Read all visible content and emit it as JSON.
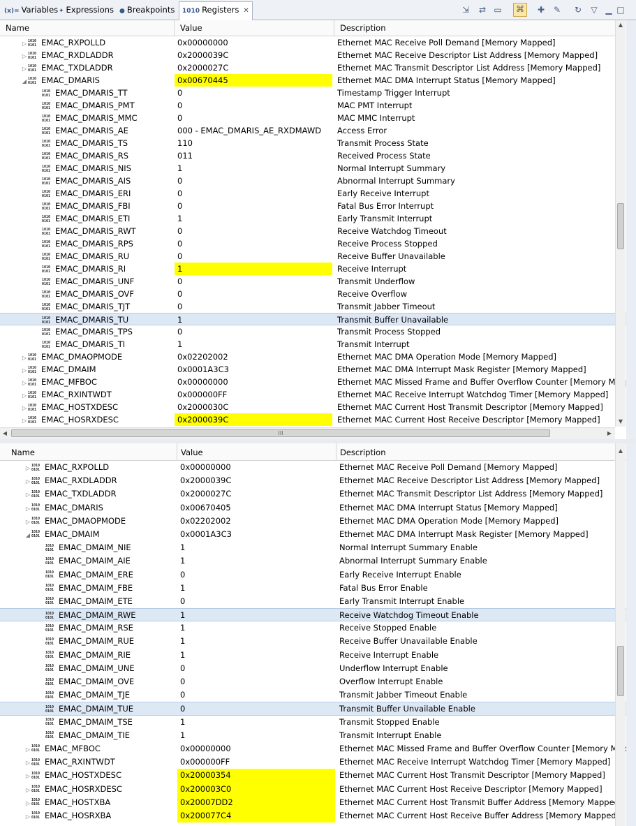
{
  "tabs": [
    {
      "icon": "(x)=",
      "label": "Variables",
      "active": false
    },
    {
      "icon": "✦",
      "label": "Expressions",
      "active": false
    },
    {
      "icon": "●",
      "label": "Breakpoints",
      "active": false
    },
    {
      "icon": "1010",
      "label": "Registers",
      "active": true
    }
  ],
  "columns": {
    "name": "Name",
    "value": "Value",
    "description": "Description"
  },
  "scroll_marker": "III",
  "highlight_color": "#ffff00",
  "top_pane": {
    "rows": [
      {
        "level": 1,
        "expand": "collapsed",
        "name": "EMAC_RXPOLLD",
        "value": "0x00000000",
        "desc": "Ethernet MAC Receive Poll Demand [Memory Mapped]"
      },
      {
        "level": 1,
        "expand": "collapsed",
        "name": "EMAC_RXDLADDR",
        "value": "0x2000039C",
        "desc": "Ethernet MAC Receive Descriptor List Address [Memory Mapped]"
      },
      {
        "level": 1,
        "expand": "collapsed",
        "name": "EMAC_TXDLADDR",
        "value": "0x2000027C",
        "desc": "Ethernet MAC Transmit Descriptor List Address [Memory Mapped]"
      },
      {
        "level": 1,
        "expand": "expanded",
        "name": "EMAC_DMARIS",
        "value": "0x00670445",
        "desc": "Ethernet MAC DMA Interrupt Status [Memory Mapped]",
        "highlight": true
      },
      {
        "level": 2,
        "name": "EMAC_DMARIS_TT",
        "value": "0",
        "desc": "Timestamp Trigger Interrupt"
      },
      {
        "level": 2,
        "name": "EMAC_DMARIS_PMT",
        "value": "0",
        "desc": "MAC PMT Interrupt"
      },
      {
        "level": 2,
        "name": "EMAC_DMARIS_MMC",
        "value": "0",
        "desc": "MAC MMC Interrupt"
      },
      {
        "level": 2,
        "name": "EMAC_DMARIS_AE",
        "value": "000 - EMAC_DMARIS_AE_RXDMAWD",
        "desc": "Access Error"
      },
      {
        "level": 2,
        "name": "EMAC_DMARIS_TS",
        "value": "110",
        "desc": "Transmit Process State"
      },
      {
        "level": 2,
        "name": "EMAC_DMARIS_RS",
        "value": "011",
        "desc": "Received Process State"
      },
      {
        "level": 2,
        "name": "EMAC_DMARIS_NIS",
        "value": "1",
        "desc": "Normal Interrupt Summary"
      },
      {
        "level": 2,
        "name": "EMAC_DMARIS_AIS",
        "value": "0",
        "desc": "Abnormal Interrupt Summary"
      },
      {
        "level": 2,
        "name": "EMAC_DMARIS_ERI",
        "value": "0",
        "desc": "Early Receive Interrupt"
      },
      {
        "level": 2,
        "name": "EMAC_DMARIS_FBI",
        "value": "0",
        "desc": "Fatal Bus Error Interrupt"
      },
      {
        "level": 2,
        "name": "EMAC_DMARIS_ETI",
        "value": "1",
        "desc": "Early Transmit Interrupt"
      },
      {
        "level": 2,
        "name": "EMAC_DMARIS_RWT",
        "value": "0",
        "desc": "Receive Watchdog Timeout"
      },
      {
        "level": 2,
        "name": "EMAC_DMARIS_RPS",
        "value": "0",
        "desc": "Receive Process Stopped"
      },
      {
        "level": 2,
        "name": "EMAC_DMARIS_RU",
        "value": "0",
        "desc": "Receive Buffer Unavailable"
      },
      {
        "level": 2,
        "name": "EMAC_DMARIS_RI",
        "value": "1",
        "desc": "Receive Interrupt",
        "highlight": true
      },
      {
        "level": 2,
        "name": "EMAC_DMARIS_UNF",
        "value": "0",
        "desc": "Transmit Underflow"
      },
      {
        "level": 2,
        "name": "EMAC_DMARIS_OVF",
        "value": "0",
        "desc": "Receive Overflow"
      },
      {
        "level": 2,
        "name": "EMAC_DMARIS_TJT",
        "value": "0",
        "desc": "Transmit Jabber Timeout"
      },
      {
        "level": 2,
        "name": "EMAC_DMARIS_TU",
        "value": "1",
        "desc": "Transmit Buffer Unavailable",
        "selected": true
      },
      {
        "level": 2,
        "name": "EMAC_DMARIS_TPS",
        "value": "0",
        "desc": "Transmit Process Stopped"
      },
      {
        "level": 2,
        "name": "EMAC_DMARIS_TI",
        "value": "1",
        "desc": "Transmit Interrupt"
      },
      {
        "level": 1,
        "expand": "collapsed",
        "name": "EMAC_DMAOPMODE",
        "value": "0x02202002",
        "desc": "Ethernet MAC DMA Operation Mode [Memory Mapped]"
      },
      {
        "level": 1,
        "expand": "collapsed",
        "name": "EMAC_DMAIM",
        "value": "0x0001A3C3",
        "desc": "Ethernet MAC DMA Interrupt Mask Register [Memory Mapped]"
      },
      {
        "level": 1,
        "expand": "collapsed",
        "name": "EMAC_MFBOC",
        "value": "0x00000000",
        "desc": "Ethernet MAC Missed Frame and Buffer Overflow Counter [Memory Mappe"
      },
      {
        "level": 1,
        "expand": "collapsed",
        "name": "EMAC_RXINTWDT",
        "value": "0x000000FF",
        "desc": "Ethernet MAC Receive Interrupt Watchdog Timer [Memory Mapped]"
      },
      {
        "level": 1,
        "expand": "collapsed",
        "name": "EMAC_HOSTXDESC",
        "value": "0x2000030C",
        "desc": "Ethernet MAC Current Host Transmit Descriptor [Memory Mapped]"
      },
      {
        "level": 1,
        "expand": "collapsed",
        "name": "EMAC_HOSRXDESC",
        "value": "0x2000039C",
        "desc": "Ethernet MAC Current Host Receive Descriptor [Memory Mapped]",
        "highlight": true
      }
    ]
  },
  "bottom_pane": {
    "rows": [
      {
        "level": 1,
        "expand": "collapsed",
        "name": "EMAC_RXPOLLD",
        "value": "0x00000000",
        "desc": "Ethernet MAC Receive Poll Demand [Memory Mapped]"
      },
      {
        "level": 1,
        "expand": "collapsed",
        "name": "EMAC_RXDLADDR",
        "value": "0x2000039C",
        "desc": "Ethernet MAC Receive Descriptor List Address [Memory Mapped]"
      },
      {
        "level": 1,
        "expand": "collapsed",
        "name": "EMAC_TXDLADDR",
        "value": "0x2000027C",
        "desc": "Ethernet MAC Transmit Descriptor List Address [Memory Mapped]"
      },
      {
        "level": 1,
        "expand": "collapsed",
        "name": "EMAC_DMARIS",
        "value": "0x00670405",
        "desc": "Ethernet MAC DMA Interrupt Status [Memory Mapped]"
      },
      {
        "level": 1,
        "expand": "collapsed",
        "name": "EMAC_DMAOPMODE",
        "value": "0x02202002",
        "desc": "Ethernet MAC DMA Operation Mode [Memory Mapped]"
      },
      {
        "level": 1,
        "expand": "expanded",
        "name": "EMAC_DMAIM",
        "value": "0x0001A3C3",
        "desc": "Ethernet MAC DMA Interrupt Mask Register [Memory Mapped]"
      },
      {
        "level": 2,
        "name": "EMAC_DMAIM_NIE",
        "value": "1",
        "desc": "Normal Interrupt Summary Enable"
      },
      {
        "level": 2,
        "name": "EMAC_DMAIM_AIE",
        "value": "1",
        "desc": "Abnormal Interrupt Summary Enable"
      },
      {
        "level": 2,
        "name": "EMAC_DMAIM_ERE",
        "value": "0",
        "desc": "Early Receive Interrupt Enable"
      },
      {
        "level": 2,
        "name": "EMAC_DMAIM_FBE",
        "value": "1",
        "desc": "Fatal Bus Error Enable"
      },
      {
        "level": 2,
        "name": "EMAC_DMAIM_ETE",
        "value": "0",
        "desc": "Early Transmit Interrupt Enable"
      },
      {
        "level": 2,
        "name": "EMAC_DMAIM_RWE",
        "value": "1",
        "desc": "Receive Watchdog Timeout Enable",
        "selected": true
      },
      {
        "level": 2,
        "name": "EMAC_DMAIM_RSE",
        "value": "1",
        "desc": "Receive Stopped Enable"
      },
      {
        "level": 2,
        "name": "EMAC_DMAIM_RUE",
        "value": "1",
        "desc": "Receive Buffer Unavailable Enable"
      },
      {
        "level": 2,
        "name": "EMAC_DMAIM_RIE",
        "value": "1",
        "desc": "Receive Interrupt Enable"
      },
      {
        "level": 2,
        "name": "EMAC_DMAIM_UNE",
        "value": "0",
        "desc": "Underflow Interrupt Enable"
      },
      {
        "level": 2,
        "name": "EMAC_DMAIM_OVE",
        "value": "0",
        "desc": "Overflow Interrupt Enable"
      },
      {
        "level": 2,
        "name": "EMAC_DMAIM_TJE",
        "value": "0",
        "desc": "Transmit Jabber Timeout Enable"
      },
      {
        "level": 2,
        "name": "EMAC_DMAIM_TUE",
        "value": "0",
        "desc": "Transmit Buffer Unvailable Enable",
        "selected": true
      },
      {
        "level": 2,
        "name": "EMAC_DMAIM_TSE",
        "value": "1",
        "desc": "Transmit Stopped Enable"
      },
      {
        "level": 2,
        "name": "EMAC_DMAIM_TIE",
        "value": "1",
        "desc": "Transmit Interrupt Enable"
      },
      {
        "level": 1,
        "expand": "collapsed",
        "name": "EMAC_MFBOC",
        "value": "0x00000000",
        "desc": "Ethernet MAC Missed Frame and Buffer Overflow Counter [Memory Mappe"
      },
      {
        "level": 1,
        "expand": "collapsed",
        "name": "EMAC_RXINTWDT",
        "value": "0x000000FF",
        "desc": "Ethernet MAC Receive Interrupt Watchdog Timer [Memory Mapped]"
      },
      {
        "level": 1,
        "expand": "collapsed",
        "name": "EMAC_HOSTXDESC",
        "value": "0x20000354",
        "desc": "Ethernet MAC Current Host Transmit Descriptor [Memory Mapped]",
        "highlight": true
      },
      {
        "level": 1,
        "expand": "collapsed",
        "name": "EMAC_HOSRXDESC",
        "value": "0x200003C0",
        "desc": "Ethernet MAC Current Host Receive Descriptor [Memory Mapped]",
        "highlight": true
      },
      {
        "level": 1,
        "expand": "collapsed",
        "name": "EMAC_HOSTXBA",
        "value": "0x20007DD2",
        "desc": "Ethernet MAC Current Host Transmit Buffer Address [Memory Mapped]",
        "highlight": true
      },
      {
        "level": 1,
        "expand": "collapsed",
        "name": "EMAC_HOSRXBA",
        "value": "0x200077C4",
        "desc": "Ethernet MAC Current Host Receive Buffer Address [Memory Mapped]",
        "highlight": true
      }
    ]
  },
  "toolbar_icons": [
    "restore-icon",
    "layout-icon",
    "collapse-icon",
    "pin-icon",
    "new-group-icon",
    "open-group-icon",
    "refresh-icon",
    "view-menu-icon",
    "minimize-icon",
    "maximize-icon"
  ]
}
